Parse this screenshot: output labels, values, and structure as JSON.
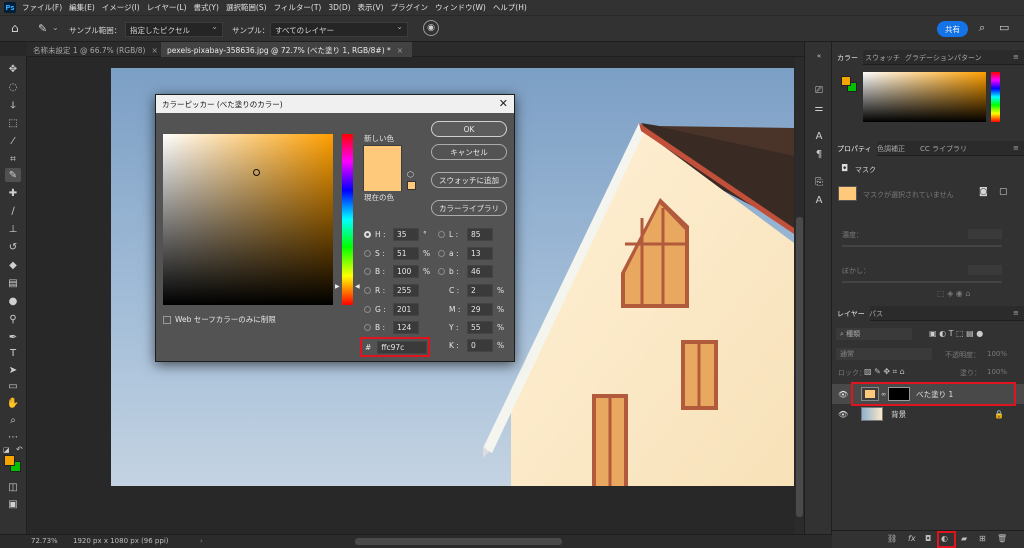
{
  "menu": [
    "ファイル(F)",
    "編集(E)",
    "イメージ(I)",
    "レイヤー(L)",
    "書式(Y)",
    "選択範囲(S)",
    "フィルター(T)",
    "3D(D)",
    "表示(V)",
    "プラグイン",
    "ウィンドウ(W)",
    "ヘルプ(H)"
  ],
  "app_logo": "Ps",
  "options": {
    "sample_size_label": "サンプル範囲：",
    "sample_size_value": "指定したピクセル",
    "sample_label": "サンプル：",
    "sample_value": "すべてのレイヤー",
    "share_label": "共有"
  },
  "tabs": [
    {
      "label": "名称未設定 1 @ 66.7% (RGB/8)",
      "close": "×"
    },
    {
      "label": "pexels-pixabay-358636.jpg @ 72.7% (べた塗り 1, RGB/8#) *",
      "close": "×"
    }
  ],
  "status": {
    "zoom": "72.73%",
    "doc": "1920 px x 1080 px (96 ppi)"
  },
  "dialog": {
    "title": "カラーピッカー (べた塗りのカラー)",
    "close": "✕",
    "ok": "OK",
    "cancel": "キャンセル",
    "add_swatch": "スウォッチに追加",
    "libraries": "カラーライブラリ",
    "new_label": "新しい色",
    "current_label": "現在の色",
    "new_color": "#ffc97c",
    "current_color": "#ffc97c",
    "websafe": "Web セーフカラーのみに制限",
    "hsb": [
      {
        "label": "H :",
        "value": "35",
        "unit": "°",
        "selected": true
      },
      {
        "label": "S :",
        "value": "51",
        "unit": "%",
        "selected": false
      },
      {
        "label": "B :",
        "value": "100",
        "unit": "%",
        "selected": false
      }
    ],
    "rgb": [
      {
        "label": "R :",
        "value": "255"
      },
      {
        "label": "G :",
        "value": "201"
      },
      {
        "label": "B :",
        "value": "124"
      }
    ],
    "lab": [
      {
        "label": "L :",
        "value": "85"
      },
      {
        "label": "a :",
        "value": "13"
      },
      {
        "label": "b :",
        "value": "46"
      }
    ],
    "cmyk": [
      {
        "label": "C :",
        "value": "2",
        "unit": "%"
      },
      {
        "label": "M :",
        "value": "29",
        "unit": "%"
      },
      {
        "label": "Y :",
        "value": "55",
        "unit": "%"
      },
      {
        "label": "K :",
        "value": "0",
        "unit": "%"
      }
    ],
    "hex_prefix": "#",
    "hex": "ffc97c"
  },
  "panels": {
    "color_tabs": [
      "カラー",
      "スウォッチ",
      "グラデーション",
      "パターン"
    ],
    "props_tabs": [
      "プロパティ",
      "色調補正",
      "CC ライブラリ"
    ],
    "mask_label": "マスク",
    "mask_msg": "マスクが選択されていません",
    "density": "濃度：",
    "feather": "ぼかし：",
    "layer_tabs": [
      "レイヤー",
      "パス"
    ],
    "layer_search": "種類",
    "blend": "通常",
    "opacity_label": "不透明度：",
    "opacity_value": "100%",
    "lock_label": "ロック：",
    "fill_label": "塗り：",
    "fill_value": "100%",
    "layers": [
      {
        "name": "べた塗り 1",
        "selected": true
      },
      {
        "name": "背景",
        "selected": false
      }
    ]
  }
}
